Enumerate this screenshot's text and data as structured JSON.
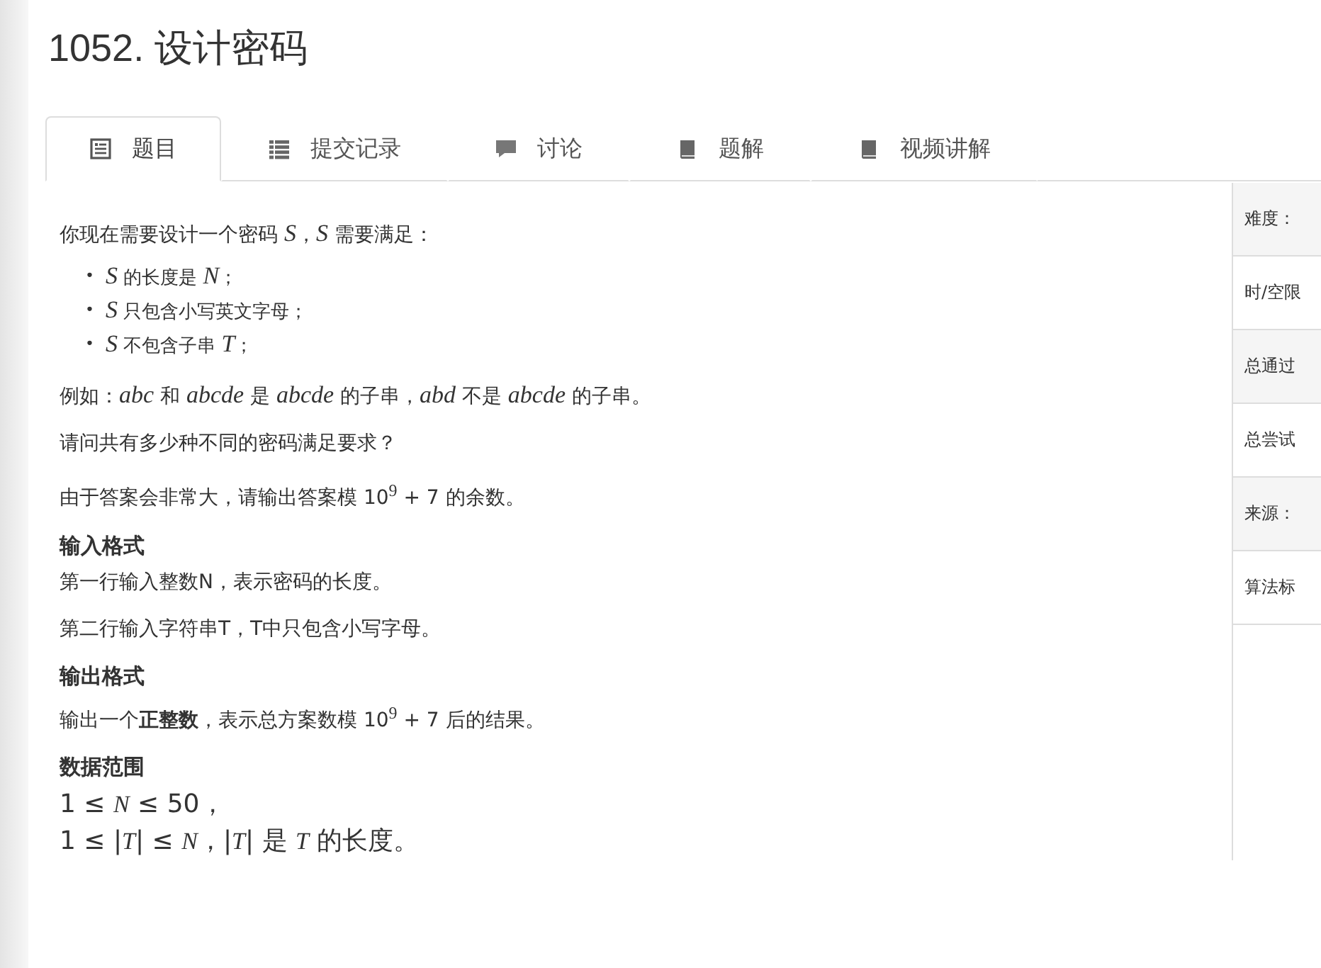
{
  "title": "1052. 设计密码",
  "tabs": [
    {
      "label": "题目",
      "selected": true
    },
    {
      "label": "提交记录",
      "selected": false
    },
    {
      "label": "讨论",
      "selected": false
    },
    {
      "label": "题解",
      "selected": false
    },
    {
      "label": "视频讲解",
      "selected": false
    }
  ],
  "content": [
    {
      "kind": "paragraph",
      "text": "你现在需要设计一个密码 *S*，*S* 需要满足："
    },
    {
      "kind": "list",
      "items": [
        {
          "bullet": "•",
          "text": "*S* 的长度是 *N*；"
        },
        {
          "bullet": "•",
          "text": "*S* 只包含小写英文字母；"
        },
        {
          "bullet": "•",
          "text": "*S* 不包含子串 *T*；"
        }
      ]
    },
    {
      "kind": "paragraph",
      "text": "例如：*abc* 和 *abcde* 是 *abcde* 的子串，*abd* 不是 *abcde* 的子串。"
    },
    {
      "kind": "paragraph",
      "text": "请问共有多少种不同的密码满足要求？"
    },
    {
      "kind": "paragraph",
      "text": "由于答案会非常大，请输出答案模 10$^{9}$ + 7 的余数。"
    },
    {
      "kind": "heading",
      "text": "输入格式"
    },
    {
      "kind": "paragraph",
      "text": "第一行输入整数N，表示密码的长度。"
    },
    {
      "kind": "paragraph",
      "text": "第二行输入字符串T，T中只包含小写字母。"
    },
    {
      "kind": "heading",
      "text": "输出格式"
    },
    {
      "kind": "paragraph",
      "text": "输出一个**正整数**，表示总方案数模 10$^{9}$ + 7 后的结果。"
    },
    {
      "kind": "heading",
      "text": "数据范围"
    },
    {
      "kind": "lines",
      "items": [
        "1 ≤ *N* ≤ 50，",
        "1 ≤ |*T*| ≤ *N*，|*T*| 是 *T* 的长度。"
      ]
    }
  ],
  "info_panel": [
    "难度：",
    "时/空限",
    "总通过",
    "总尝试",
    "来源：",
    "算法标"
  ]
}
